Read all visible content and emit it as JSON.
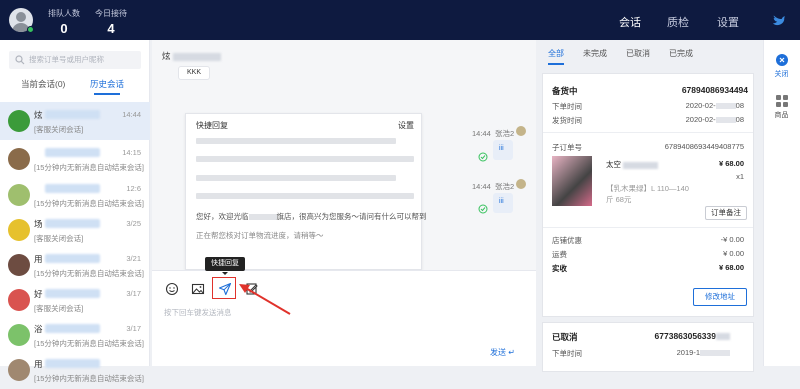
{
  "header": {
    "stats": [
      {
        "label": "排队人数",
        "value": "0"
      },
      {
        "label": "今日接待",
        "value": "4"
      }
    ],
    "nav": [
      {
        "label": "会话",
        "active": true
      },
      {
        "label": "质检"
      },
      {
        "label": "设置"
      }
    ]
  },
  "sidebar_left": {
    "search_placeholder": "搜索订单号或用户昵称",
    "tabs": [
      "当前会话(0)",
      "历史会话"
    ],
    "items": [
      {
        "name": "炫",
        "time": "14:44",
        "msg": "[客服关闭会话]",
        "color": "#3b9b3a"
      },
      {
        "name": "",
        "time": "14:15",
        "msg": "[15分钟内无新消息自动结束会话]",
        "color": "#8a6b4a"
      },
      {
        "name": "",
        "time": "12:6",
        "msg": "[15分钟内无新消息自动结束会话]",
        "color": "#9fbf6e"
      },
      {
        "name": "场",
        "time": "3/25",
        "msg": "[客服关闭会话]",
        "color": "#e6c12d"
      },
      {
        "name": "用",
        "time": "3/21",
        "msg": "[15分钟内无新消息自动结束会话]",
        "color": "#6d4c41"
      },
      {
        "name": "好",
        "time": "3/17",
        "msg": "[客服关闭会话]",
        "color": "#d9534f"
      },
      {
        "name": "浴",
        "time": "3/17",
        "msg": "[15分钟内无新消息自动结束会话]",
        "color": "#7cc26a"
      },
      {
        "name": "用",
        "time": "",
        "msg": "[15分钟内无新消息自动结束会话]",
        "color": "#a08870"
      }
    ]
  },
  "chat": {
    "contact": "炫",
    "bubble1": "KKK",
    "agent": "张浩2",
    "time1": "14:44",
    "time2": "14:44",
    "bubble_text": "iii",
    "quick_reply": {
      "title": "快捷回复",
      "settings": "设置",
      "text1": "您好，欢迎光临",
      "text1b": "旗店，很高兴为您服务～请问有什么可以帮到",
      "text2": "正在帮您核对订单物流进度，请稍等～"
    },
    "tooltip": "快捷回复",
    "placeholder": "按下回车键发送消息",
    "send": "发送 ↵"
  },
  "orders": {
    "tabs": [
      "全部",
      "未完成",
      "已取消",
      "已完成"
    ],
    "order1": {
      "status": "备货中",
      "id": "67894086934494",
      "order_time_label": "下单时间",
      "order_time": "2020-02-",
      "order_time_tail": "08",
      "ship_time_label": "发货时间",
      "ship_time": "2020-02-",
      "ship_time_tail": "08",
      "sub_label": "子订单号",
      "sub_id": "6789408693449408775",
      "product_name": "太空",
      "price": "¥ 68.00",
      "qty": "x1",
      "spec": "【乳木果绿】L 110—140",
      "spec2": "斤 68元",
      "remark_btn": "订单备注",
      "shop_discount_label": "店铺优惠",
      "shop_discount": "-¥ 0.00",
      "freight_label": "运费",
      "freight": "¥ 0.00",
      "paid_label": "实收",
      "paid": "¥ 68.00",
      "edit_btn": "修改地址"
    },
    "order2": {
      "status": "已取消",
      "id": "6773863056339",
      "order_time_label": "下单时间",
      "order_time": "2019-1"
    }
  },
  "sidebar_right": {
    "close_label": "关闭",
    "goods_label": "商品"
  }
}
